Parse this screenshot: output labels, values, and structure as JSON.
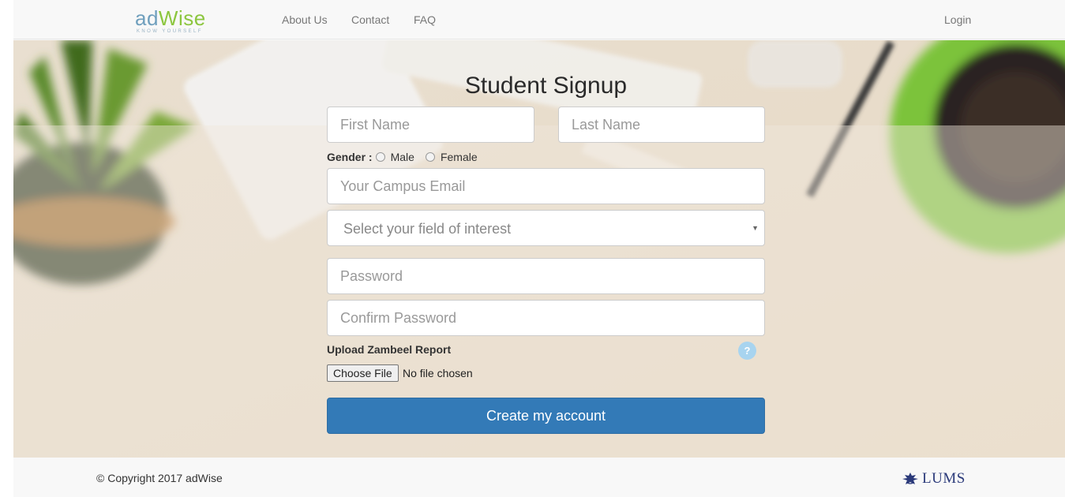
{
  "navbar": {
    "logo_main_part1": "ad",
    "logo_main_part2": "Wise",
    "logo_tagline": "KNOW YOURSELF",
    "links": [
      "About Us",
      "Contact",
      "FAQ"
    ],
    "login": "Login"
  },
  "form": {
    "title": "Student Signup",
    "first_name_placeholder": "First Name",
    "last_name_placeholder": "Last Name",
    "gender_label": "Gender :",
    "gender_options": [
      "Male",
      "Female"
    ],
    "email_placeholder": "Your Campus Email",
    "interest_select_text": "Select your field of interest",
    "password_placeholder": "Password",
    "confirm_password_placeholder": "Confirm Password",
    "upload_label": "Upload Zambeel Report",
    "help_symbol": "?",
    "file_button": "Choose File",
    "file_status": "No file chosen",
    "submit_label": "Create my account"
  },
  "footer": {
    "copyright": "© Copyright 2017 adWise",
    "partner_logo_text": "LUMS"
  },
  "colors": {
    "primary_button": "#337ab7",
    "logo_blue": "#6f9fbd",
    "logo_green": "#8cc63f",
    "lums_navy": "#2b3a7a"
  },
  "icons": {
    "help": "question-circle-icon",
    "select_arrow": "caret-down-icon",
    "lums_crest": "lums-crest-icon"
  }
}
